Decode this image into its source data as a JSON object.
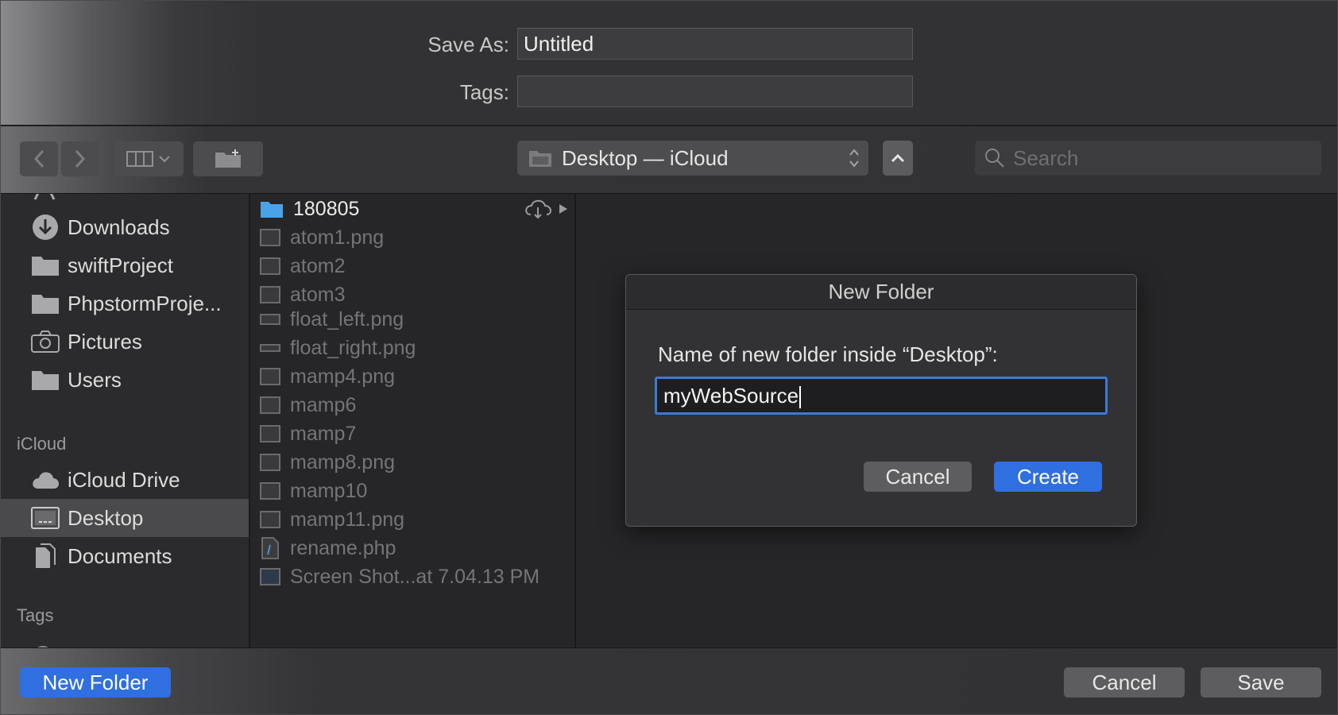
{
  "form": {
    "save_as_label": "Save As:",
    "save_as_value": "Untitled",
    "tags_label": "Tags:",
    "tags_value": ""
  },
  "toolbar": {
    "location": "Desktop — iCloud",
    "search_placeholder": "Search"
  },
  "sidebar": {
    "items": [
      {
        "label": "Downloads",
        "icon": "download-icon"
      },
      {
        "label": "swiftProject",
        "icon": "folder-icon"
      },
      {
        "label": "PhpstormProje...",
        "icon": "folder-icon"
      },
      {
        "label": "Pictures",
        "icon": "camera-icon"
      },
      {
        "label": "Users",
        "icon": "folder-icon"
      }
    ],
    "icloud_heading": "iCloud",
    "icloud_items": [
      {
        "label": "iCloud Drive",
        "icon": "cloud-icon"
      },
      {
        "label": "Desktop",
        "icon": "desktop-icon",
        "selected": true
      },
      {
        "label": "Documents",
        "icon": "document-icon"
      }
    ],
    "tags_heading": "Tags"
  },
  "files": [
    {
      "name": "180805",
      "type": "folder"
    },
    {
      "name": "atom1.png",
      "type": "file"
    },
    {
      "name": "atom2",
      "type": "file"
    },
    {
      "name": "atom3",
      "type": "file"
    },
    {
      "name": "float_left.png",
      "type": "file"
    },
    {
      "name": "float_right.png",
      "type": "file"
    },
    {
      "name": "mamp4.png",
      "type": "file"
    },
    {
      "name": "mamp6",
      "type": "file"
    },
    {
      "name": "mamp7",
      "type": "file"
    },
    {
      "name": "mamp8.png",
      "type": "file"
    },
    {
      "name": "mamp10",
      "type": "file"
    },
    {
      "name": "mamp11.png",
      "type": "file"
    },
    {
      "name": "rename.php",
      "type": "file"
    },
    {
      "name": "Screen Shot...at 7.04.13 PM",
      "type": "file"
    }
  ],
  "dialog": {
    "title": "New Folder",
    "prompt": "Name of new folder inside “Desktop”:",
    "value": "myWebSource",
    "cancel_label": "Cancel",
    "create_label": "Create"
  },
  "bottom": {
    "new_folder_label": "New Folder",
    "cancel_label": "Cancel",
    "save_label": "Save"
  },
  "colors": {
    "accent": "#2f6fe0",
    "focus_ring": "#3b7ad6"
  }
}
